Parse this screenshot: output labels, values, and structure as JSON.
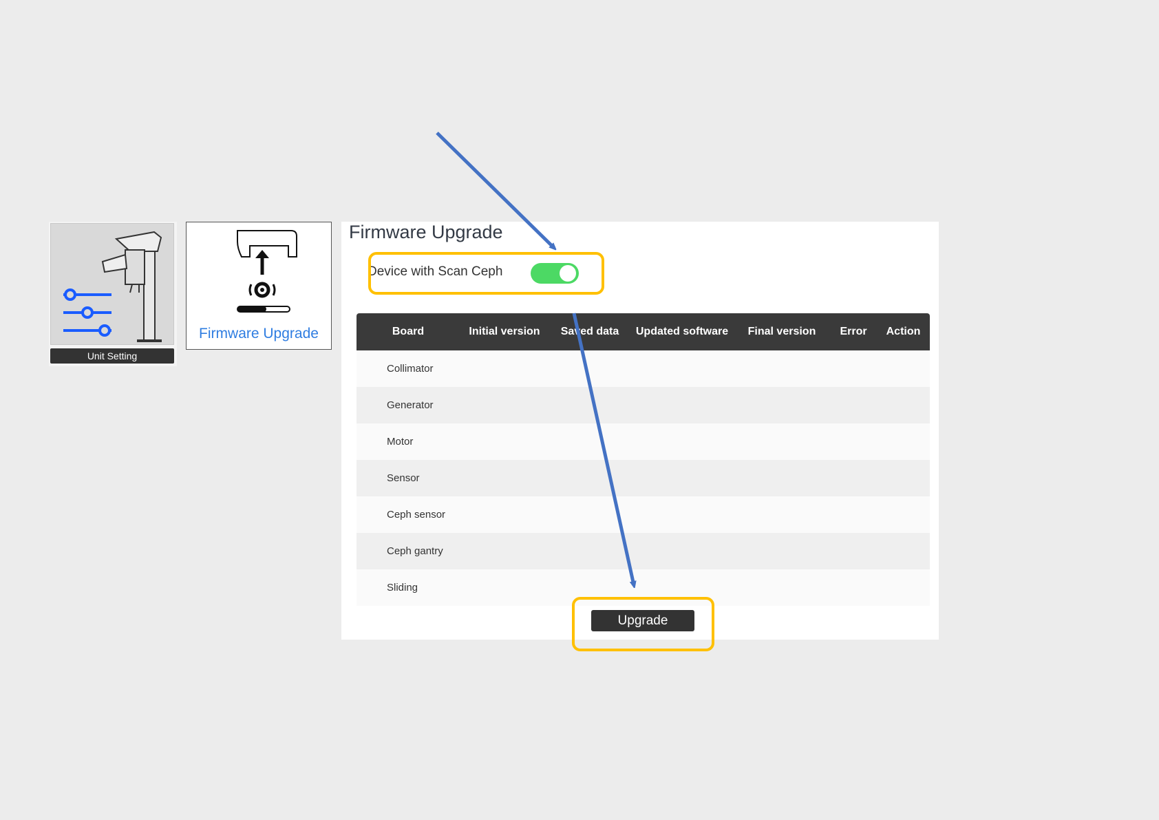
{
  "tiles": {
    "unit_setting": {
      "label": "Unit Setting",
      "icon": "dental-xray-unit-sliders-icon"
    },
    "firmware_upgrade": {
      "label": "Firmware Upgrade",
      "icon": "firmware-upgrade-gear-icon"
    }
  },
  "panel": {
    "title": "Firmware Upgrade",
    "toggle": {
      "label": "Device with Scan Ceph",
      "on": true,
      "color": "#4cd964"
    },
    "table": {
      "columns": [
        "Board",
        "Initial version",
        "Saved data",
        "Updated software",
        "Final version",
        "Error",
        "Action"
      ],
      "rows": [
        "Collimator",
        "Generator",
        "Motor",
        "Sensor",
        "Ceph sensor",
        "Ceph gantry",
        "Sliding"
      ]
    },
    "upgrade_label": "Upgrade"
  },
  "colors": {
    "highlight": "#ffc000",
    "arrow": "#4472c4",
    "accent": "#2f7de1"
  }
}
